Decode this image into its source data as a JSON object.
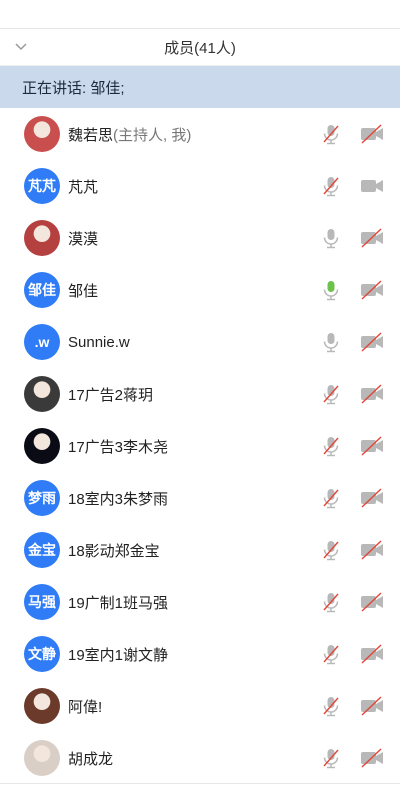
{
  "header": {
    "title": "成员(41人)"
  },
  "speaking": {
    "text": "正在讲话: 邹佳;"
  },
  "members": [
    {
      "name": "魏若思",
      "role": "(主持人, 我)",
      "avatar": {
        "type": "photo",
        "label": "",
        "color": "#c94f4f"
      },
      "mic": "muted",
      "camera": "off"
    },
    {
      "name": "芃芃",
      "role": "",
      "avatar": {
        "type": "text",
        "label": "芃芃"
      },
      "mic": "muted",
      "camera": "on"
    },
    {
      "name": "漠漠",
      "role": "",
      "avatar": {
        "type": "photo",
        "label": "",
        "color": "#b54040"
      },
      "mic": "on",
      "camera": "off"
    },
    {
      "name": "邹佳",
      "role": "",
      "avatar": {
        "type": "text",
        "label": "邹佳"
      },
      "mic": "speaking",
      "camera": "off"
    },
    {
      "name": "Sunnie.w",
      "role": "",
      "avatar": {
        "type": "text",
        "label": ".w"
      },
      "mic": "on",
      "camera": "off"
    },
    {
      "name": "17广告2蒋玥",
      "role": "",
      "avatar": {
        "type": "photo",
        "label": "",
        "color": "#3a3a3a"
      },
      "mic": "muted",
      "camera": "off"
    },
    {
      "name": "17广告3李木尧",
      "role": "",
      "avatar": {
        "type": "photo",
        "label": "",
        "color": "#0b0b16"
      },
      "mic": "muted",
      "camera": "off"
    },
    {
      "name": "18室内3朱梦雨",
      "role": "",
      "avatar": {
        "type": "text",
        "label": "梦雨"
      },
      "mic": "muted",
      "camera": "off"
    },
    {
      "name": "18影动郑金宝",
      "role": "",
      "avatar": {
        "type": "text",
        "label": "金宝"
      },
      "mic": "muted",
      "camera": "off"
    },
    {
      "name": "19广制1班马强",
      "role": "",
      "avatar": {
        "type": "text",
        "label": "马强"
      },
      "mic": "muted",
      "camera": "off"
    },
    {
      "name": "19室内1谢文静",
      "role": "",
      "avatar": {
        "type": "text",
        "label": "文静"
      },
      "mic": "muted",
      "camera": "off"
    },
    {
      "name": "阿偉!",
      "role": "",
      "avatar": {
        "type": "photo",
        "label": "",
        "color": "#6b3a2a"
      },
      "mic": "muted",
      "camera": "off"
    },
    {
      "name": "胡成龙",
      "role": "",
      "avatar": {
        "type": "photo",
        "label": "",
        "color": "#d9cfc7"
      },
      "mic": "muted",
      "camera": "off"
    }
  ],
  "colors": {
    "accent": "#2f7cf6",
    "speaking_bg": "#cad9ec",
    "icon_gray": "#b8b8b8",
    "mic_active": "#6cc24a",
    "muted_slash": "#e0463a"
  }
}
